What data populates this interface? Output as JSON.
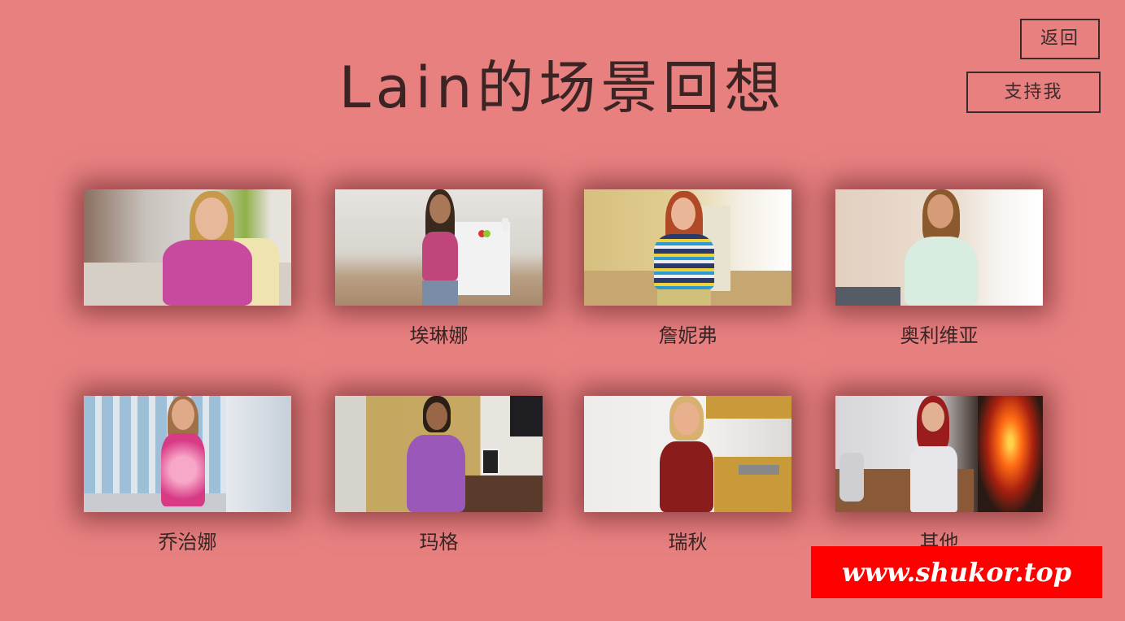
{
  "title": "Lain的场景回想",
  "buttons": {
    "back": "返回",
    "support": "支持我"
  },
  "scenes": [
    {
      "label": "",
      "scene": "car-interior"
    },
    {
      "label": "埃琳娜",
      "scene": "kitchen"
    },
    {
      "label": "詹妮弗",
      "scene": "hallway"
    },
    {
      "label": "奥利维亚",
      "scene": "patio"
    },
    {
      "label": "乔治娜",
      "scene": "blue-room"
    },
    {
      "label": "玛格",
      "scene": "living-room"
    },
    {
      "label": "瑞秋",
      "scene": "kitchen-2"
    },
    {
      "label": "其他",
      "scene": "gallery"
    }
  ],
  "watermark": "www.shukor.top"
}
